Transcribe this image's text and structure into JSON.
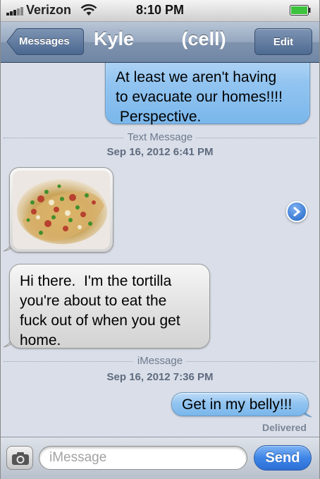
{
  "status_bar": {
    "carrier": "Verizon",
    "time": "8:10 PM",
    "icons": [
      "signal-bars-icon",
      "wifi-icon",
      "battery-icon"
    ]
  },
  "nav": {
    "back_label": "Messages",
    "title": "Kyle         (cell)",
    "edit_label": "Edit"
  },
  "messages": [
    {
      "direction": "outgoing",
      "lines": [
        "At least we aren't having",
        "to evacuate our homes!!!!",
        " Perspective."
      ]
    },
    {
      "type": "divider",
      "label": "Text Message",
      "timestamp": "Sep 16, 2012 6:41 PM"
    },
    {
      "direction": "incoming",
      "type": "photo",
      "icon": "food-photo-thumbnail"
    },
    {
      "direction": "incoming",
      "lines": [
        "Hi there.  I'm the tortilla",
        "you're about to eat the",
        "fuck out of when you get",
        "home."
      ]
    },
    {
      "type": "divider",
      "label": "iMessage",
      "timestamp": "Sep 16, 2012 7:36 PM"
    },
    {
      "direction": "outgoing",
      "text": "Get in my belly!!!",
      "status": "Delivered"
    }
  ],
  "input_bar": {
    "placeholder": "iMessage",
    "value": "",
    "send_label": "Send"
  },
  "colors": {
    "outgoing_bubble": "#92c4f0",
    "incoming_bubble": "#e2e2e2",
    "background": "#d9dee8",
    "send_button": "#3f85e6"
  }
}
